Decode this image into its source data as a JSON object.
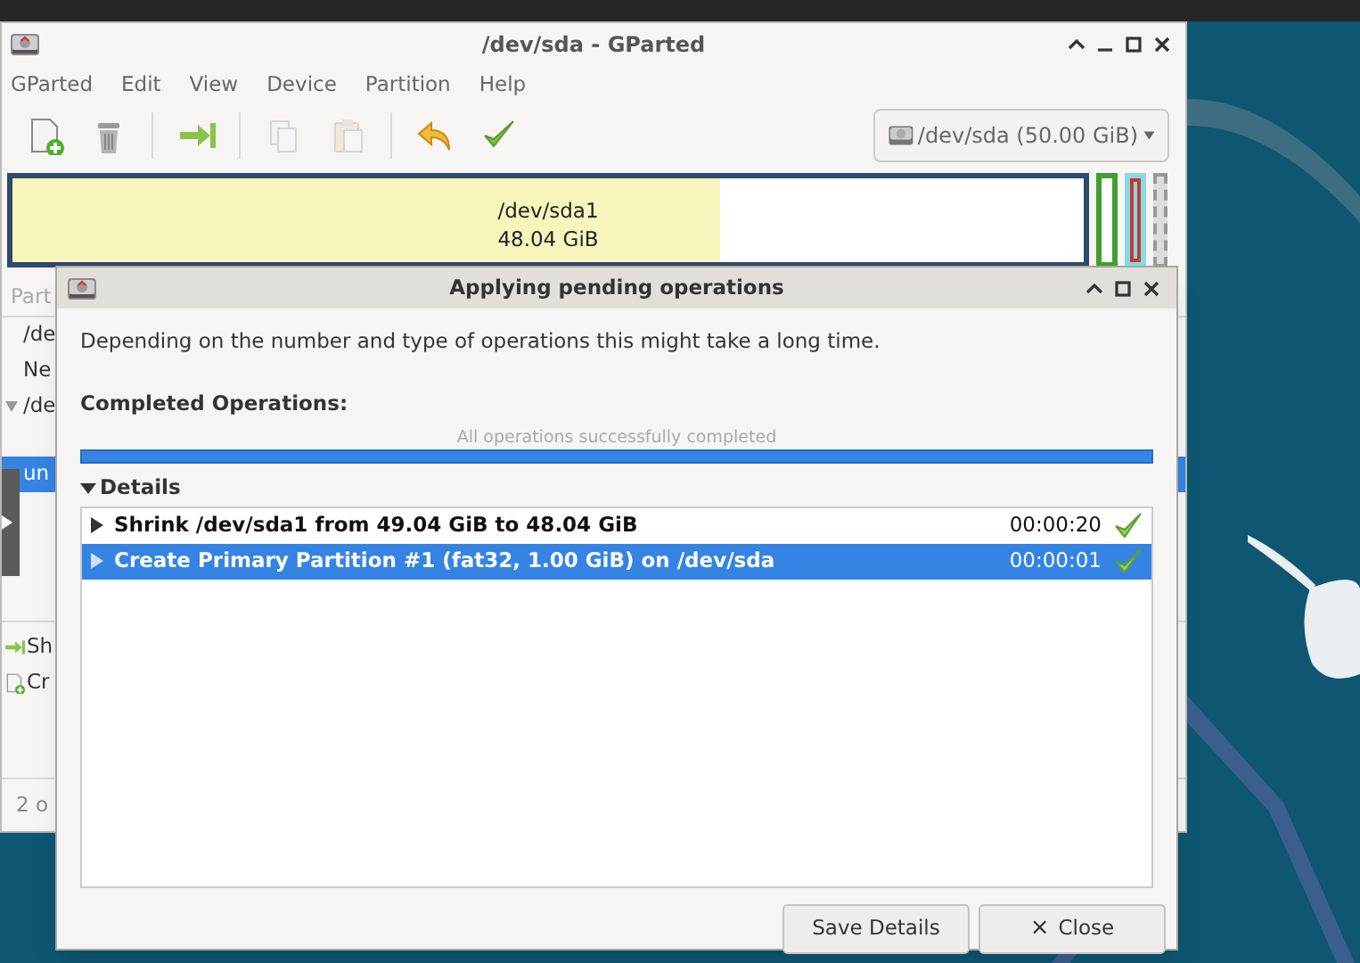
{
  "main_window": {
    "title": "/dev/sda - GParted",
    "menu": [
      "GParted",
      "Edit",
      "View",
      "Device",
      "Partition",
      "Help"
    ],
    "toolbar": [
      {
        "kind": "new",
        "disabled": false
      },
      {
        "kind": "delete",
        "disabled": false
      },
      {
        "kind": "resize",
        "disabled": false
      },
      {
        "kind": "copy",
        "disabled": true
      },
      {
        "kind": "paste",
        "disabled": true
      },
      {
        "kind": "undo",
        "disabled": false
      },
      {
        "kind": "apply",
        "disabled": false
      }
    ],
    "device_selector": "/dev/sda (50.00 GiB)",
    "partition_map": {
      "label": "/dev/sda1",
      "size": "48.04 GiB",
      "level": 0.66
    },
    "partition_list": {
      "header": "Part",
      "rows": [
        {
          "kind": "item",
          "text": "/de",
          "selected": false
        },
        {
          "kind": "item",
          "text": "Ne",
          "selected": false
        },
        {
          "kind": "parent",
          "text": "/de",
          "selected": false
        },
        {
          "kind": "item",
          "text": "un",
          "selected": true
        }
      ]
    },
    "pending_operations": [
      {
        "kind": "resize",
        "text": "Sh"
      },
      {
        "kind": "new",
        "text": "Cr"
      }
    ],
    "status_bar": "2 o"
  },
  "dialog": {
    "title": "Applying pending operations",
    "message": "Depending on the number and type of operations this might take a long time.",
    "completed_label": "Completed Operations:",
    "progress": {
      "label": "All operations successfully completed",
      "level": 1
    },
    "details": {
      "label": "Details",
      "expanded": true,
      "operations": [
        {
          "text": "Shrink /dev/sda1 from 49.04 GiB to 48.04 GiB",
          "time": "00:00:20",
          "selected": false,
          "done": true
        },
        {
          "text": "Create Primary Partition #1 (fat32, 1.00 GiB) on /dev/sda",
          "time": "00:00:01",
          "selected": true,
          "done": true
        }
      ]
    },
    "buttons": [
      {
        "label": "Save Details"
      },
      {
        "icon": "×",
        "label": "Close"
      }
    ]
  }
}
